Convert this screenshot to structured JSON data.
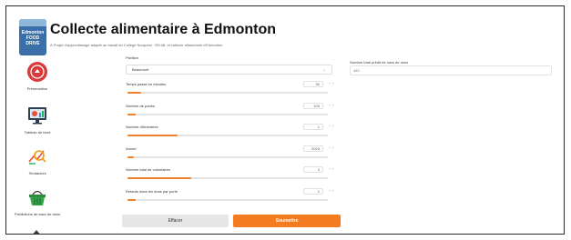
{
  "header": {
    "logo_text": "Edmonton FOOD DRIVE",
    "title": "Collecte alimentaire à Edmonton",
    "subtitle": "À Projet d'apprentissage adapté au travail du Collège Norquest · BS-ML et collecte alimentaire d'Edmonton"
  },
  "sidebar": {
    "items": [
      {
        "label": "Présentation",
        "icon": "food-drive-icon"
      },
      {
        "label": "Tableau de bord",
        "icon": "dashboard-icon"
      },
      {
        "label": "Tendances",
        "icon": "trends-icon"
      },
      {
        "label": "Prédictions de sacs de dons",
        "icon": "basket-icon"
      }
    ]
  },
  "form": {
    "pavillon_label": "Pavillon",
    "pavillon_value": "Beaumont",
    "fields": [
      {
        "label": "Temps passé en minutes",
        "value": "30",
        "fill": 0.07
      },
      {
        "label": "Nombre de portes",
        "value": "100",
        "fill": 0.04
      },
      {
        "label": "Nombre d'itinéraires",
        "value": "1",
        "fill": 0.25
      },
      {
        "label": "Année",
        "value": "2023",
        "fill": 0.03
      },
      {
        "label": "Nombre total de volontaires",
        "value": "3",
        "fill": 0.32
      },
      {
        "label": "Retards dans les dons par porte",
        "value": "1",
        "fill": 0.04
      }
    ],
    "minus": "−",
    "plus": "+",
    "reset_label": "Effacer",
    "submit_label": "Soumettre"
  },
  "output": {
    "label": "Nombre total prédit de sacs de dons",
    "value": "482"
  },
  "colors": {
    "accent": "#f47b20",
    "logo": "#3a6fa8"
  }
}
